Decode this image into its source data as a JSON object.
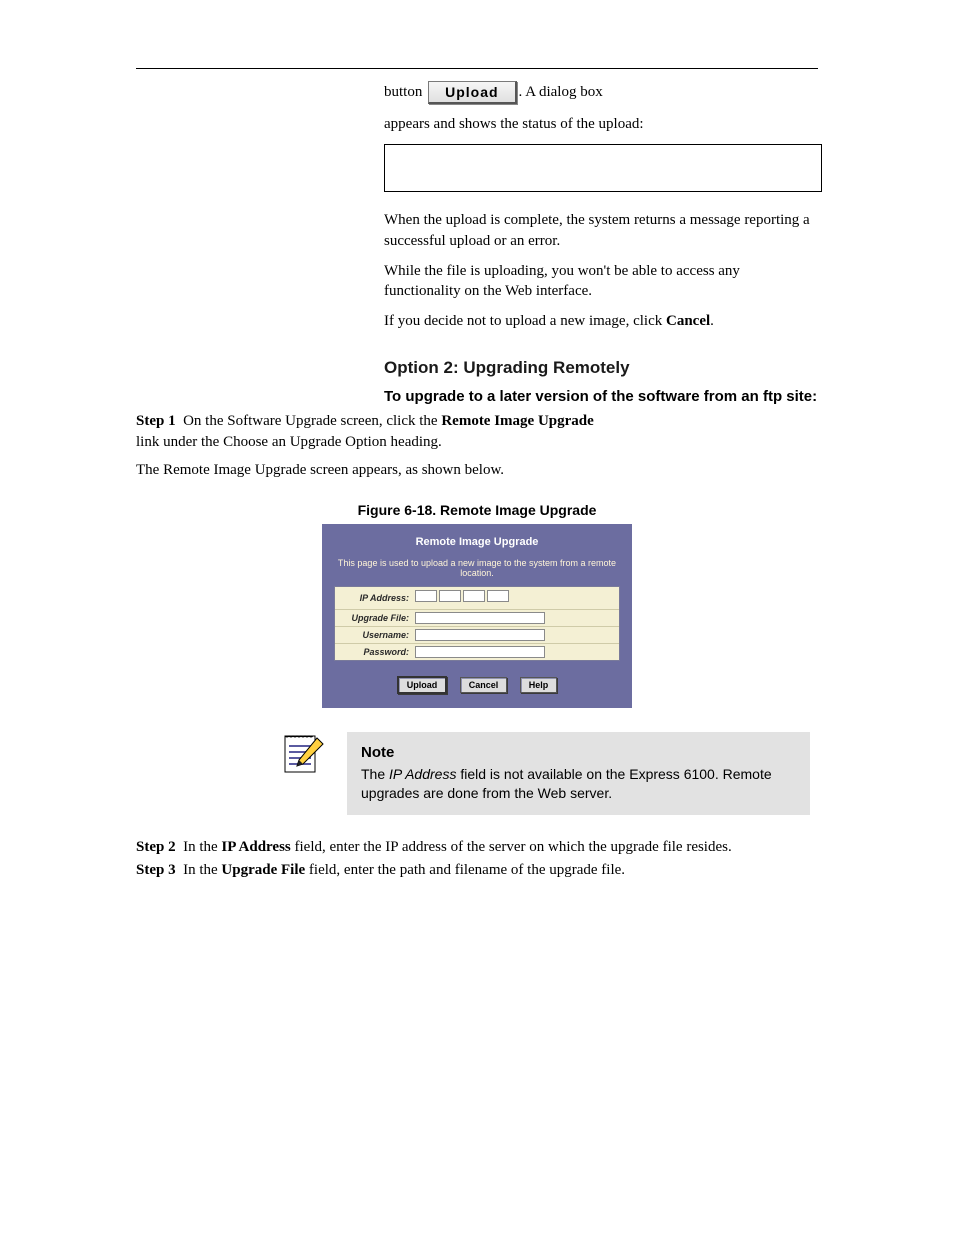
{
  "intro": {
    "line1_prefix": "button ",
    "upload_label": "Upload",
    "line1_suffix": ". A dialog box",
    "line2": "appears and shows the status of the upload:"
  },
  "upload_done": {
    "line1": "When the upload is complete, the system returns a message reporting a successful upload or an error.",
    "line2": "While the file is uploading, you won't be able to access any functionality on the Web interface."
  },
  "cancel_text": {
    "part1": "If you decide not to upload a new image, click ",
    "bold": "Cancel",
    "part2": "."
  },
  "section": {
    "heading": "Option 2: Upgrading Remotely",
    "sub": "To upgrade to a later version of the software from an ftp site:",
    "step_label": "Step",
    "step1_num": "1",
    "step1_text": "On the Software Upgrade screen, click the ",
    "step1_bold": "Remote Image Upgrade",
    "step1_text2": " link under the Choose an Upgrade Option heading.",
    "step1_text3": "The Remote Image Upgrade screen appears, as shown below."
  },
  "figure": {
    "caption": "Figure 6-18. Remote Image Upgrade"
  },
  "panel": {
    "title": "Remote Image Upgrade",
    "desc": "This page is used to upload a new image to the system from a remote location.",
    "labels": {
      "ip": "IP Address:",
      "file": "Upgrade File:",
      "user": "Username:",
      "pass": "Password:"
    },
    "buttons": {
      "upload": "Upload",
      "cancel": "Cancel",
      "help": "Help"
    }
  },
  "note": {
    "title": "Note",
    "body_before": "The ",
    "body_italic": "IP Address",
    "body_after": " field is not available on the Express 6100. Remote upgrades are done from the Web server."
  },
  "steps2": {
    "step2_num": "2",
    "step2_text_before": "In the ",
    "step2_bold": "IP Address",
    "step2_text_after": " field, enter the IP address of the server on which the upgrade file resides.",
    "step3_num": "3",
    "step3_text_before": "In the ",
    "step3_bold": "Upgrade File",
    "step3_text_after": " field, enter the path and filename of the upgrade file."
  }
}
